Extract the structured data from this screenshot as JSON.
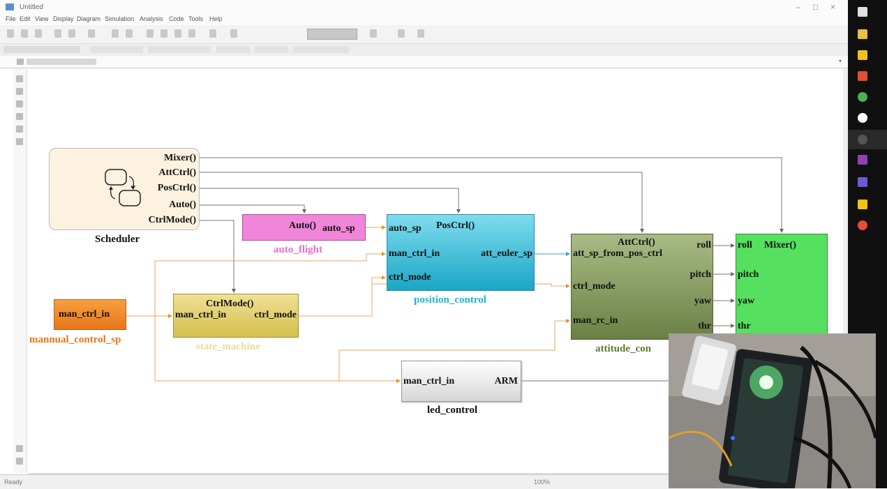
{
  "window": {
    "title": "Untitled",
    "menu": [
      "File",
      "Edit",
      "View",
      "Display",
      "Diagram",
      "Simulation",
      "Analysis",
      "Code",
      "Tools",
      "Help"
    ],
    "status_left": "Ready",
    "status_zoom": "100%"
  },
  "blocks": {
    "scheduler": {
      "name": "Scheduler",
      "ports": [
        "Mixer()",
        "AttCtrl()",
        "PosCtrl()",
        "Auto()",
        "CtrlMode()"
      ]
    },
    "auto_flight": {
      "name": "auto_flight",
      "port_trigger": "Auto()",
      "port_out": "auto_sp"
    },
    "position_control": {
      "name": "position_control",
      "trigger": "PosCtrl()",
      "in_ports": [
        "auto_sp",
        "man_ctrl_in",
        "ctrl_mode"
      ],
      "out_port": "att_euler_sp"
    },
    "attitude_control": {
      "name": "attitude_con",
      "trigger": "AttCtrl()",
      "in_ports": [
        "att_sp_from_pos_ctrl",
        "ctrl_mode",
        "man_rc_in"
      ],
      "out_ports": [
        "roll",
        "pitch",
        "yaw",
        "thr"
      ]
    },
    "mixer": {
      "trigger": "Mixer()",
      "in_ports": [
        "roll",
        "pitch",
        "yaw",
        "thr"
      ]
    },
    "manual_control": {
      "name": "mannual_control_sp",
      "port": "man_ctrl_in"
    },
    "state_machine": {
      "name": "state_machine",
      "trigger": "CtrlMode()",
      "in_port": "man_ctrl_in",
      "out_port": "ctrl_mode"
    },
    "led_control": {
      "name": "led_control",
      "in_port": "man_ctrl_in",
      "out_port": "ARM"
    }
  },
  "colors": {
    "accent_orange": "#e8761a",
    "accent_cyan": "#1aa6c6",
    "accent_pink": "#ef86d9",
    "accent_green": "#55e060"
  }
}
